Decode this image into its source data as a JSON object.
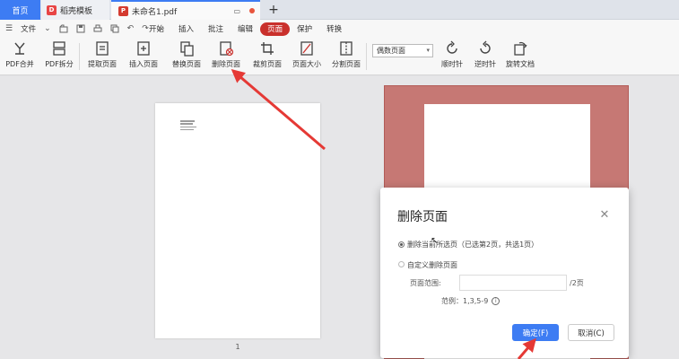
{
  "titlebar": {
    "home_tab": "首页",
    "template_tab": "稻壳模板",
    "doc_tab": "未命名1.pdf",
    "add_tab": "+"
  },
  "menubar": {
    "file_label": "文件",
    "tabs": [
      {
        "label": "开始"
      },
      {
        "label": "插入"
      },
      {
        "label": "批注"
      },
      {
        "label": "编辑"
      },
      {
        "label": "页面",
        "active": true
      },
      {
        "label": "保护"
      },
      {
        "label": "转换"
      }
    ]
  },
  "ribbon": {
    "tools": [
      {
        "label": "PDF合并",
        "icon": "pdf-merge-icon"
      },
      {
        "label": "PDF拆分",
        "icon": "pdf-split-icon"
      },
      {
        "label": "提取页面",
        "icon": "extract-page-icon"
      },
      {
        "label": "插入页面",
        "icon": "insert-page-icon"
      },
      {
        "label": "替换页面",
        "icon": "replace-page-icon"
      },
      {
        "label": "删除页面",
        "icon": "delete-page-icon"
      },
      {
        "label": "裁剪页面",
        "icon": "crop-page-icon"
      },
      {
        "label": "页面大小",
        "icon": "page-size-icon"
      },
      {
        "label": "分割页面",
        "icon": "split-page-icon"
      },
      {
        "label": "顺时针",
        "icon": "rotate-clockwise-icon"
      },
      {
        "label": "逆时针",
        "icon": "rotate-counterclockwise-icon"
      },
      {
        "label": "旋转文档",
        "icon": "rotate-document-icon"
      }
    ],
    "page_select": "偶数页面"
  },
  "canvas": {
    "page_number": "1"
  },
  "dialog": {
    "title": "删除页面",
    "option1": "删除当前所选页（已选第2页，共选1页）",
    "option2": "自定义删除页面",
    "range_label": "页面范围:",
    "range_value": "",
    "range_total": "/2页",
    "example": "范例：1,3,5-9",
    "ok_label": "确定(F)",
    "cancel_label": "取消(C)"
  },
  "colors": {
    "accent": "#3d7cf3",
    "active_tab": "#c9302c",
    "annotation": "#e53935",
    "selected_page": "#c67874"
  }
}
